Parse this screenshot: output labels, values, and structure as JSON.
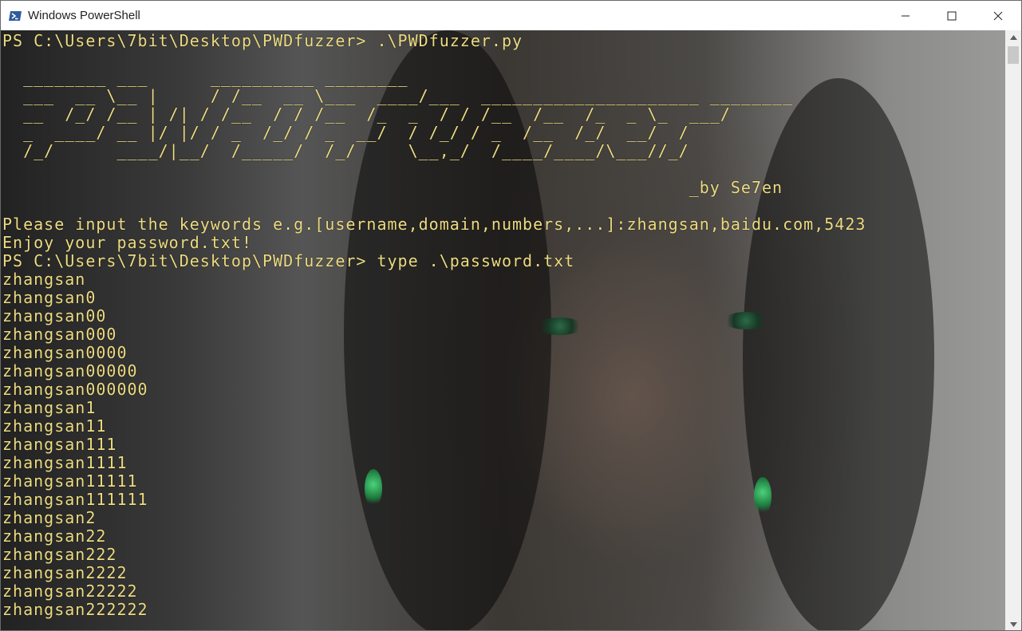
{
  "window": {
    "title": "Windows PowerShell"
  },
  "console": {
    "lines": [
      "PS C:\\Users\\7bit\\Desktop\\PWDfuzzer> .\\PWDfuzzer.py",
      "",
      "  ________ ___      __________ ________",
      "  ___  __ \\__ |     / /__  __ \\___  ____/___  _____________________ ________",
      "  __  /_/ /__ | /| / /__  / / /__  /_  _  / / /__  /__  /_  _ \\_  ___/",
      "  _  ____/ __ |/ |/ / _  /_/ / _  __/  / /_/ / _  /__  /_/  __/  /",
      "  /_/      ____/|__/  /_____/  /_/     \\__,_/  /____/____/\\___//_/",
      "",
      "                                                                  _by Se7en",
      "",
      "Please input the keywords e.g.[username,domain,numbers,...]:zhangsan,baidu.com,5423",
      "Enjoy your password.txt!",
      "PS C:\\Users\\7bit\\Desktop\\PWDfuzzer> type .\\password.txt",
      "zhangsan",
      "zhangsan0",
      "zhangsan00",
      "zhangsan000",
      "zhangsan0000",
      "zhangsan00000",
      "zhangsan000000",
      "zhangsan1",
      "zhangsan11",
      "zhangsan111",
      "zhangsan1111",
      "zhangsan11111",
      "zhangsan111111",
      "zhangsan2",
      "zhangsan22",
      "zhangsan222",
      "zhangsan2222",
      "zhangsan22222",
      "zhangsan222222"
    ]
  },
  "colors": {
    "text": "#eedc82",
    "titlebar": "#ffffff"
  },
  "icons": {
    "app": "powershell-icon",
    "minimize": "minimize-icon",
    "maximize": "maximize-icon",
    "close": "close-icon"
  }
}
